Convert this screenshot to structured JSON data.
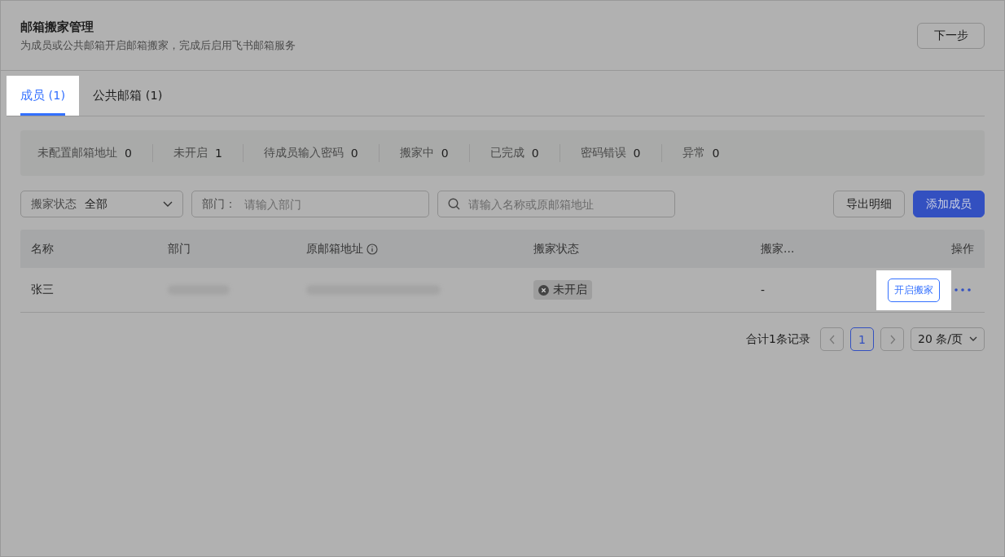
{
  "header": {
    "title": "邮箱搬家管理",
    "subtitle": "为成员或公共邮箱开启邮箱搬家，完成后启用飞书邮箱服务",
    "next_button": "下一步"
  },
  "tabs": [
    {
      "label": "成员 (1)",
      "selected": true,
      "highlighted": true
    },
    {
      "label": "公共邮箱 (1)",
      "selected": false,
      "highlighted": false
    }
  ],
  "stats": [
    {
      "label": "未配置邮箱地址",
      "count": "0"
    },
    {
      "label": "未开启",
      "count": "1"
    },
    {
      "label": "待成员输入密码",
      "count": "0"
    },
    {
      "label": "搬家中",
      "count": "0"
    },
    {
      "label": "已完成",
      "count": "0"
    },
    {
      "label": "密码错误",
      "count": "0"
    },
    {
      "label": "异常",
      "count": "0"
    }
  ],
  "filters": {
    "status_label": "搬家状态",
    "status_value": "全部",
    "department_label": "部门：",
    "department_placeholder": "请输入部门",
    "search_placeholder": "请输入名称或原邮箱地址"
  },
  "actions": {
    "export": "导出明细",
    "add": "添加成员"
  },
  "table": {
    "columns": [
      "名称",
      "部门",
      "原邮箱地址",
      "搬家状态",
      "搬家...",
      "操作"
    ],
    "rows": [
      {
        "name": "张三",
        "department_redacted": true,
        "email_redacted": true,
        "status": {
          "label": "未开启",
          "kind": "off"
        },
        "column_5": "-",
        "action": "开启搬家",
        "action_highlighted": true
      }
    ]
  },
  "pagination": {
    "total": "合计1条记录",
    "pages": [
      {
        "label": "1",
        "selected": true
      }
    ],
    "page_size": "20 条/页"
  }
}
